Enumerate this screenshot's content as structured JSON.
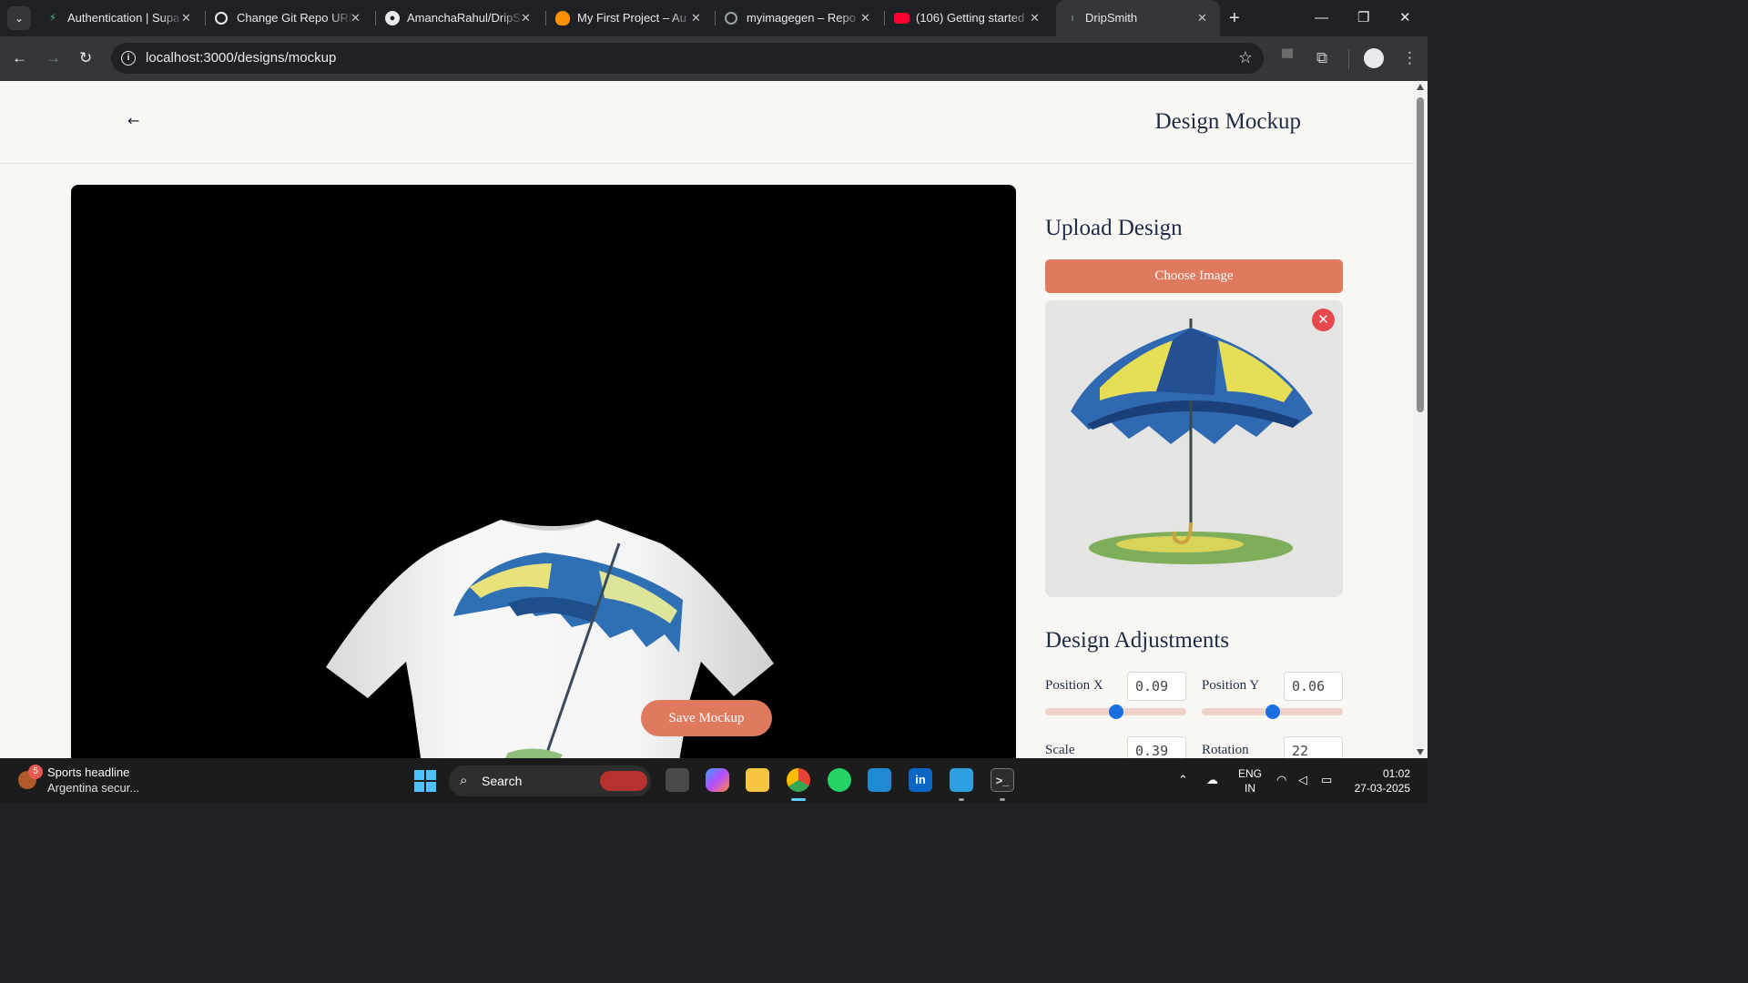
{
  "browser": {
    "tabs": [
      {
        "title": "Authentication | Supa",
        "icon": "supabase-icon"
      },
      {
        "title": "Change Git Repo URL",
        "icon": "chatgpt-icon"
      },
      {
        "title": "AmanchaRahul/DripS",
        "icon": "github-icon"
      },
      {
        "title": "My First Project – Au",
        "icon": "firebase-icon"
      },
      {
        "title": "myimagegen – Repo",
        "icon": "github-icon"
      },
      {
        "title": "(106) Getting started",
        "icon": "youtube-icon"
      },
      {
        "title": "DripSmith",
        "icon": "loading-icon"
      }
    ],
    "active_tab": 6,
    "url": "localhost:3000/designs/mockup"
  },
  "page": {
    "title": "Design Mockup",
    "save_button": "Save Mockup",
    "upload": {
      "heading": "Upload Design",
      "choose_button": "Choose Image",
      "remove_icon": "close-icon"
    },
    "adjustments": {
      "heading": "Design Adjustments",
      "position_x": {
        "label": "Position X",
        "value": "0.09",
        "slider": 0.5
      },
      "position_y": {
        "label": "Position Y",
        "value": "0.06",
        "slider": 0.5
      },
      "scale": {
        "label": "Scale",
        "value": "0.39"
      },
      "rotation": {
        "label": "Rotation",
        "value": "22"
      }
    }
  },
  "taskbar": {
    "news_badge": "5",
    "news_title": "Sports headline",
    "news_sub": "Argentina secur...",
    "search_label": "Search",
    "lang_1": "ENG",
    "lang_2": "IN",
    "time": "01:02",
    "date": "27-03-2025"
  },
  "colors": {
    "accent": "#e07a5f",
    "heading": "#1f2b45",
    "page_bg": "#f8f7f4",
    "slider_thumb": "#1a6fe0"
  }
}
